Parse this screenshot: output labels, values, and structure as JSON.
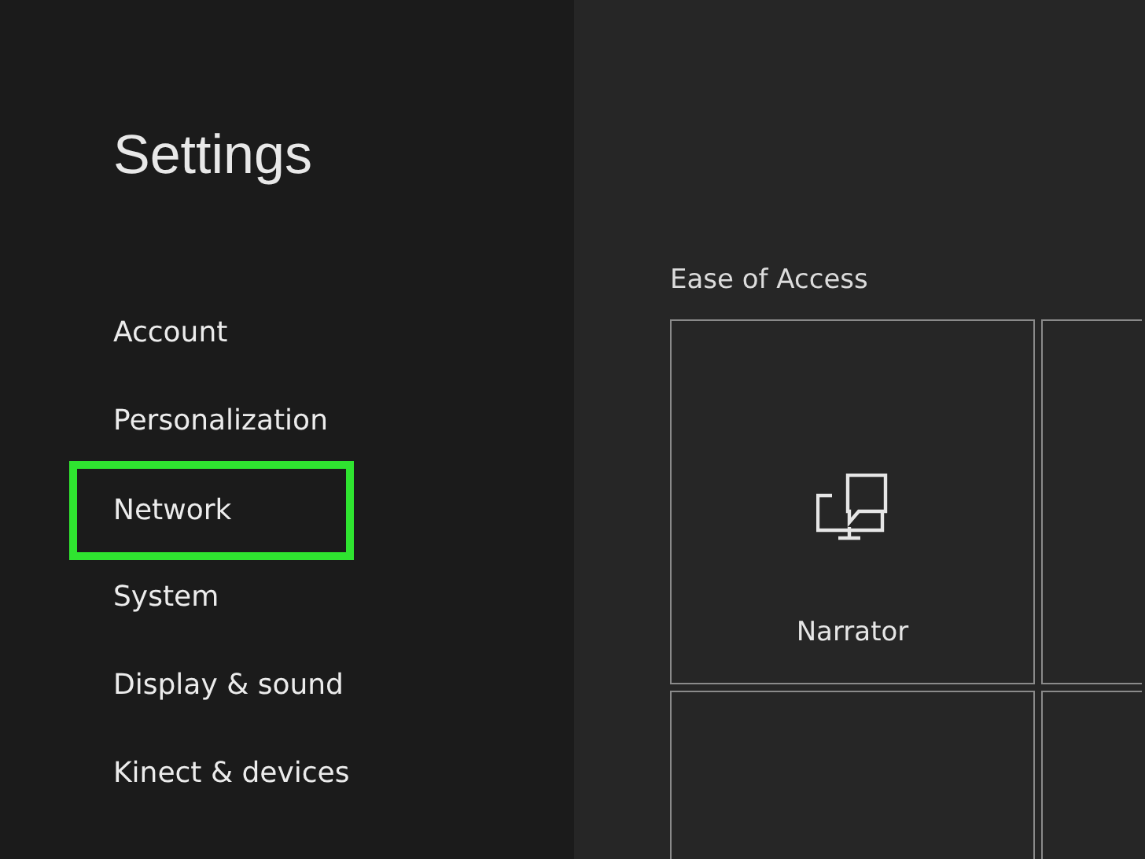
{
  "sidebar": {
    "title": "Settings",
    "items": [
      {
        "label": "Account",
        "highlighted": false
      },
      {
        "label": "Personalization",
        "highlighted": false
      },
      {
        "label": "Network",
        "highlighted": true
      },
      {
        "label": "System",
        "highlighted": false
      },
      {
        "label": "Display & sound",
        "highlighted": false
      },
      {
        "label": "Kinect & devices",
        "highlighted": false
      }
    ]
  },
  "content": {
    "section": "Ease of Access",
    "tiles": [
      {
        "kind": "narrator",
        "label": "Narrator"
      },
      {
        "kind": "blank"
      },
      {
        "kind": "blank"
      },
      {
        "kind": "blank"
      }
    ]
  }
}
